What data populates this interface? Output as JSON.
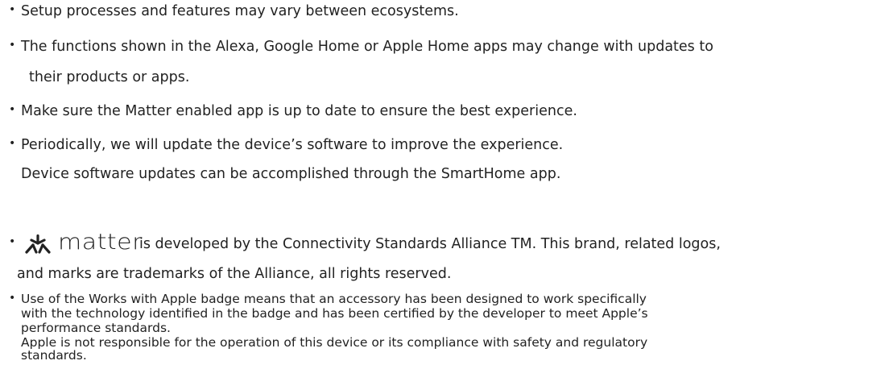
{
  "notes": {
    "bullet_glyph": "•",
    "item1": "Setup processes and features may vary between ecosystems.",
    "item2": {
      "line1": "The functions shown in the Alexa, Google Home or Apple Home apps may change with updates to",
      "line2": "their products or apps."
    },
    "item3": "Make sure the Matter enabled app is up to date to ensure the best experience.",
    "item4": {
      "line1": "Periodically, we will update the device’s software to improve the experience.",
      "line2": "Device software updates can be accomplished through the SmartHome app."
    },
    "item5": {
      "logo_text": "matter",
      "line1_rest": "is developed by the Connectivity Standards Alliance TM. This brand, related logos,",
      "line2": "and marks are trademarks of the Alliance, all rights reserved."
    },
    "item6": {
      "line1": "Use of the Works with Apple badge means that an accessory has been designed to work specifically",
      "line2": "with the technology identified in the badge and has been certified by the developer to meet Apple’s",
      "line3": "performance standards.",
      "line4": "Apple is not responsible for the operation of this device or its compliance with safety and regulatory",
      "line5": "standards."
    }
  }
}
